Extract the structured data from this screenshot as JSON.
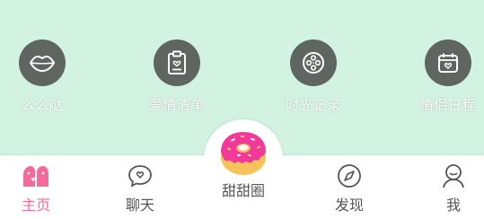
{
  "colors": {
    "top_background": "#d2f3e1",
    "icon_circle": "#5f6662",
    "active_tab": "#f36b9a",
    "inactive_tab": "#555555",
    "donut_pink": "#f2389a",
    "donut_dough": "#f6c25a"
  },
  "quick_actions": [
    {
      "label": "么么哒",
      "icon": "lips-icon"
    },
    {
      "label": "爱情清单",
      "icon": "checklist-icon"
    },
    {
      "label": "时光记录",
      "icon": "film-reel-icon"
    },
    {
      "label": "情侣日程",
      "icon": "calendar-heart-icon"
    }
  ],
  "tabbar": {
    "tabs": [
      {
        "label": "主页",
        "icon": "couple-icon",
        "active": true
      },
      {
        "label": "聊天",
        "icon": "chat-heart-icon",
        "active": false
      },
      {
        "label": "甜甜圈",
        "icon": "donut-icon",
        "active": false
      },
      {
        "label": "发现",
        "icon": "compass-icon",
        "active": false
      },
      {
        "label": "我",
        "icon": "user-icon",
        "active": false
      }
    ]
  }
}
